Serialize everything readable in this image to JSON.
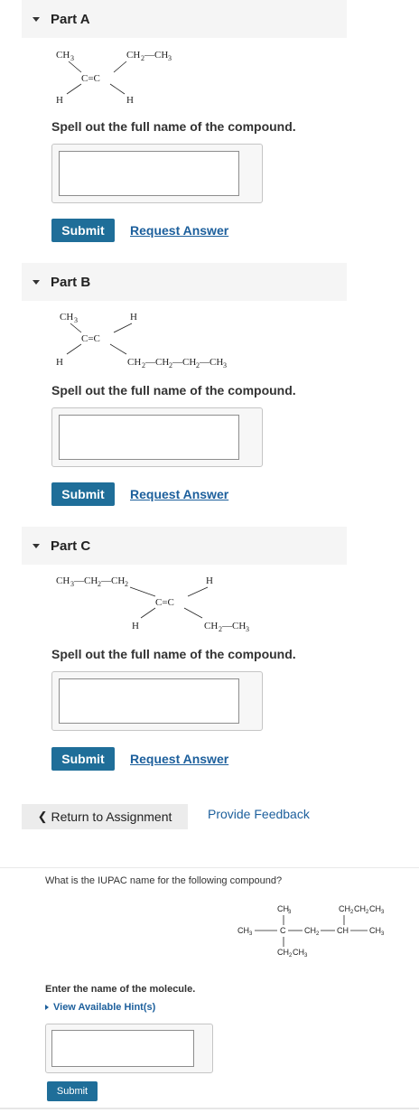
{
  "parts": [
    {
      "title": "Part A",
      "prompt": "Spell out the full name of the compound.",
      "submit_label": "Submit",
      "request_label": "Request Answer"
    },
    {
      "title": "Part B",
      "prompt": "Spell out the full name of the compound.",
      "submit_label": "Submit",
      "request_label": "Request Answer"
    },
    {
      "title": "Part C",
      "prompt": "Spell out the full name of the compound.",
      "submit_label": "Submit",
      "request_label": "Request Answer"
    }
  ],
  "structures": {
    "a": {
      "left_top": "CH",
      "left_top_sub": "3",
      "right_top": "CH",
      "right_top_sub1": "2",
      "right_top_mid": "—CH",
      "right_top_sub2": "3",
      "center": "C=C",
      "left_bottom": "H",
      "right_bottom": "H"
    },
    "b": {
      "left_top": "CH",
      "left_top_sub": "3",
      "right_top": "H",
      "center": "C=C",
      "left_bottom": "H",
      "right_bottom_chain": [
        "CH",
        "2",
        "—CH",
        "2",
        "—CH",
        "2",
        "—CH",
        "3"
      ]
    },
    "c": {
      "left_chain": [
        "CH",
        "3",
        "—CH",
        "2",
        "—CH",
        "2"
      ],
      "right_top": "H",
      "center": "C=C",
      "left_bottom": "H",
      "right_bottom_chain": [
        "CH",
        "2",
        "—CH",
        "3"
      ]
    }
  },
  "navigation": {
    "return_label": "Return to Assignment",
    "return_icon": "chevron-left-icon",
    "feedback_label": "Provide Feedback"
  },
  "question2": {
    "question": "What is the IUPAC name for the following compound?",
    "structure": {
      "top_left": "CH",
      "top_left_sub": "3",
      "top_right": "CH",
      "top_right_sub1": "2",
      "top_right_mid": "CH",
      "top_right_sub2": "2",
      "top_right_end": "CH",
      "top_right_sub3": "3",
      "main_1": "CH",
      "main_1_sub": "3",
      "main_2": "C",
      "main_3": "CH",
      "main_3_sub": "2",
      "main_4": "CH",
      "main_5": "CH",
      "main_5_sub": "3",
      "bottom": "CH",
      "bottom_sub1": "2",
      "bottom_end": "CH",
      "bottom_sub2": "3"
    },
    "enter_label": "Enter the name of the molecule.",
    "hint_label": "View Available Hint(s)",
    "submit_label": "Submit"
  },
  "colors": {
    "submit": "#1f6e99",
    "link": "#1c5f9c",
    "header_bg": "#f5f5f5"
  }
}
